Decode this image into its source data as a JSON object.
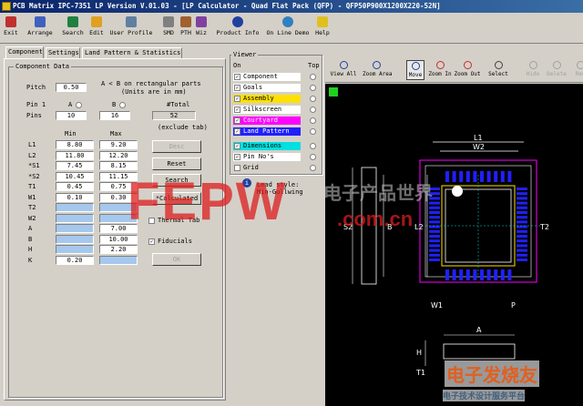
{
  "window": {
    "title": "PCB Matrix IPC-7351 LP Version  V.01.03 - [LP Calculator - Quad Flat Pack (QFP) - QFP50P900X1200X220-52N]"
  },
  "toolbar": {
    "items": [
      "Exit",
      "Arrange",
      "Search",
      "Edit",
      "User Profile",
      "SMD",
      "PTH",
      "Wiz",
      "Product Info",
      "On Line Demo",
      "Help"
    ]
  },
  "tabs": [
    "Component",
    "Settings",
    "Land Pattern & Statistics"
  ],
  "component_data": {
    "legend": "Component Data",
    "pitch_label": "Pitch",
    "pitch_value": "0.50",
    "note_line1": "A < B on rectangular parts",
    "note_line2": "(Units are in mm)",
    "pin1_label": "Pin 1",
    "pin1_a": "A",
    "pin1_b": "B",
    "pins_label": "Pins",
    "pins_a": "10",
    "pins_b": "16",
    "total_label": "#Total",
    "total_value": "52",
    "total_note": "(exclude tab)",
    "col_min": "Min",
    "col_max": "Max",
    "rows": [
      {
        "label": "L1",
        "min": "8.80",
        "max": "9.20"
      },
      {
        "label": "L2",
        "min": "11.80",
        "max": "12.20"
      },
      {
        "label": "*S1",
        "min": "7.45",
        "max": "8.15"
      },
      {
        "label": "*S2",
        "min": "10.45",
        "max": "11.15"
      },
      {
        "label": "T1",
        "min": "0.45",
        "max": "0.75"
      },
      {
        "label": "W1",
        "min": "0.10",
        "max": "0.30"
      },
      {
        "label": "T2",
        "min": "",
        "max": ""
      },
      {
        "label": "W2",
        "min": "",
        "max": ""
      },
      {
        "label": "A",
        "min": "",
        "max": "7.00"
      },
      {
        "label": "B",
        "min": "",
        "max": "10.00"
      },
      {
        "label": "H",
        "min": "",
        "max": "2.20"
      },
      {
        "label": "K",
        "min": "0.20",
        "max": ""
      }
    ]
  },
  "buttons": {
    "desc": "Desc",
    "reset": "Reset",
    "search": "Search",
    "calculated": "*Calculated",
    "thermal_tab": "Thermal Tab",
    "fiducials": "Fiducials",
    "ok": "OK"
  },
  "viewer": {
    "legend": "Viewer",
    "col_on": "On",
    "col_top": "Top",
    "layers": [
      {
        "label": "Component",
        "checked": true,
        "color": "#ffffff"
      },
      {
        "label": "Goals",
        "checked": true,
        "color": "#ffffff"
      },
      {
        "label": "Assembly",
        "checked": true,
        "color": "#ffe000"
      },
      {
        "label": "Silkscreen",
        "checked": true,
        "color": "#ffffff"
      },
      {
        "label": "Courtyard",
        "checked": true,
        "color": "#ff00ff"
      },
      {
        "label": "Land Pattern",
        "checked": true,
        "color": "#2020ff"
      },
      {
        "label": "Dimensions",
        "checked": true,
        "color": "#00e0e0"
      },
      {
        "label": "Pin No's",
        "checked": true,
        "color": "#ffffff"
      },
      {
        "label": "Grid",
        "checked": false,
        "color": "#d4d0c8"
      }
    ],
    "lead_style_label": "Lead style:",
    "lead_style_value": "Min-Gullwing",
    "tools": [
      "View All",
      "Zoom Area",
      "Move",
      "Zoom In",
      "Zoom Out",
      "Select",
      "Hide",
      "Delete",
      "Rem"
    ]
  },
  "drawing_labels": {
    "L1": "L1",
    "W2": "W2",
    "L2": "L2",
    "S2": "S2",
    "B": "B",
    "T2": "T2",
    "W1": "W1",
    "P": "P",
    "A": "A",
    "H": "H",
    "T1": "T1"
  },
  "watermark": {
    "main": "FEPW",
    "sub": ".com.cn",
    "cn": "电子产品世界",
    "logo_cn": "电子发烧友",
    "logo_bottom": "电子技术设计服务平台"
  },
  "colors": {
    "titlebar": "#0a246a",
    "land_pattern": "#2020ff",
    "courtyard": "#ff00ff",
    "assembly": "#ffe000",
    "dimension": "#00e0e0"
  }
}
